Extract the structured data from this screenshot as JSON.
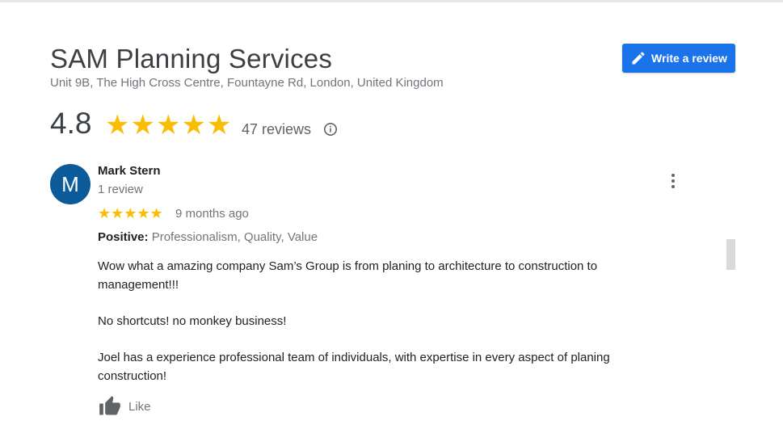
{
  "business": {
    "name": "SAM Planning Services",
    "address": "Unit 9B, The High Cross Centre, Fountayne Rd, London, United Kingdom",
    "rating": "4.8",
    "stars": "★★★★★",
    "reviews_count": "47 reviews"
  },
  "actions": {
    "write_review_label": "Write a review"
  },
  "review": {
    "avatar_letter": "M",
    "reviewer_name": "Mark Stern",
    "reviewer_meta": "1 review",
    "stars": "★★★★★",
    "time": "9 months ago",
    "positive_label": "Positive:",
    "positive_values": "Professionalism, Quality, Value",
    "paragraphs": [
      "Wow what a amazing company Sam’s Group is from planing to architecture to construction to management!!!",
      "No shortcuts! no monkey business!",
      "Joel has a experience professional team of individuals, with expertise in every aspect of planing construction!"
    ],
    "like_label": "Like"
  },
  "colors": {
    "accent": "#1a73e8",
    "star": "#fbbc04",
    "avatar": "#0b5a9a"
  }
}
